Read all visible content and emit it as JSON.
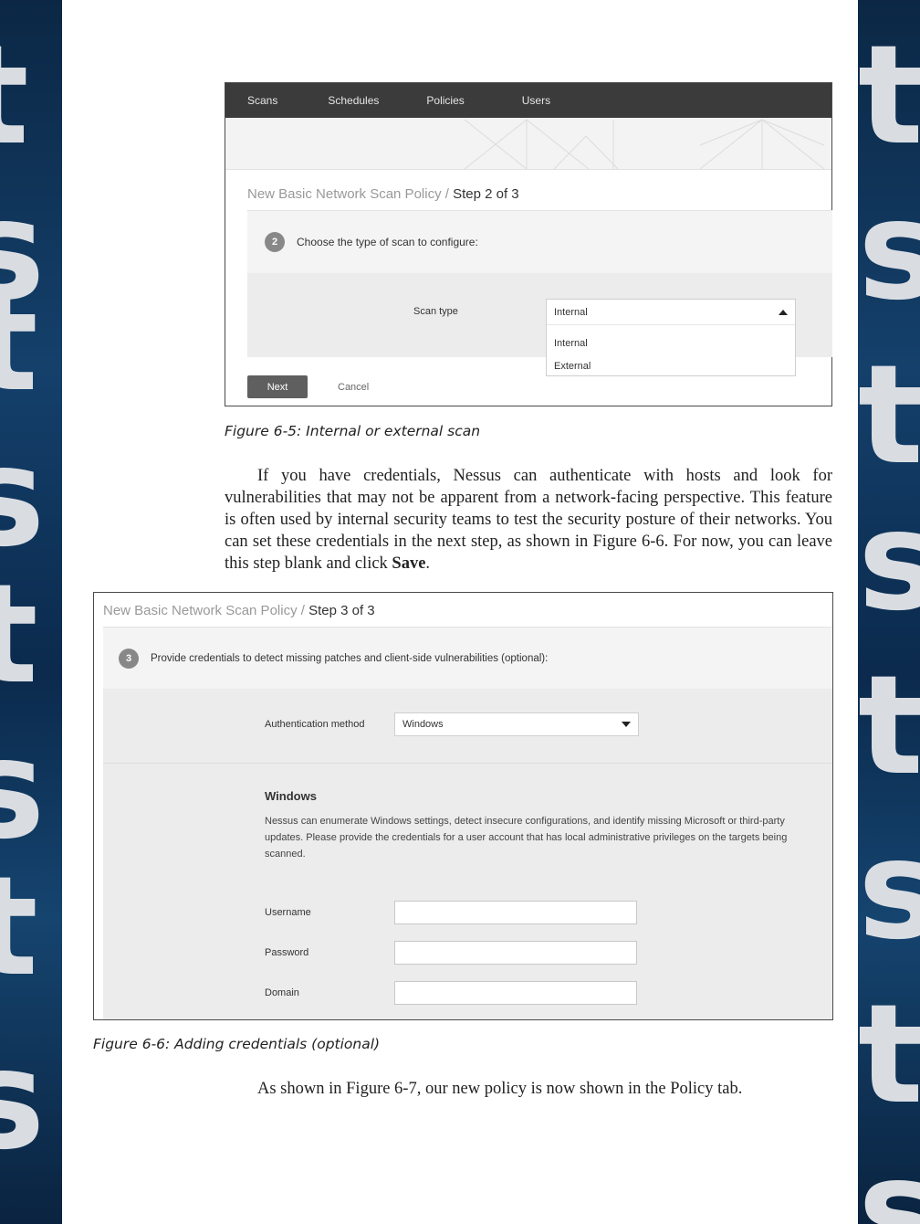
{
  "figure1": {
    "nav_tabs": [
      "Scans",
      "Schedules",
      "Policies",
      "Users"
    ],
    "heading_prefix": "New Basic Network Scan Policy /",
    "heading_step": "Step 2 of 3",
    "step_number": "2",
    "step_instruction": "Choose the type of scan to configure:",
    "scan_type_label": "Scan type",
    "scan_type_value": "Internal",
    "scan_type_options": [
      "Internal",
      "External"
    ],
    "next_label": "Next",
    "cancel_label": "Cancel",
    "caption": "Figure 6-5: Internal or external scan"
  },
  "paragraph1": {
    "text_before_bold": "If you have credentials, Nessus can authenticate with hosts and look for vulnerabilities that may not be apparent from a network-facing perspective. This feature is often used by internal security teams to test the security posture of their networks. You can set these credentials in the next step, as shown in Figure 6-6. For now, you can leave this step blank and click ",
    "bold": "Save",
    "text_after_bold": "."
  },
  "figure2": {
    "heading_prefix": "New Basic Network Scan Policy /",
    "heading_step": "Step 3 of 3",
    "step_number": "3",
    "step_instruction": "Provide credentials to detect missing patches and client-side vulnerabilities (optional):",
    "auth_label": "Authentication method",
    "auth_value": "Windows",
    "section_title": "Windows",
    "section_description": "Nessus can enumerate Windows settings, detect insecure configurations, and identify missing Microsoft or third-party updates. Please provide the credentials for a user account that has local administrative privileges on the targets being scanned.",
    "username_label": "Username",
    "username_value": "",
    "password_label": "Password",
    "password_value": "",
    "domain_label": "Domain",
    "domain_value": "",
    "caption": "Figure 6-6: Adding credentials (optional)"
  },
  "paragraph2": {
    "text": "As shown in Figure 6-7, our new policy is now shown in the Policy tab."
  },
  "colors": {
    "navbar": "#3b3b3b",
    "step_badge": "#888888",
    "next_button": "#5f5f5f",
    "side_background": "#0c2a4a"
  },
  "icons": [
    "caret-up-icon",
    "caret-down-icon"
  ]
}
